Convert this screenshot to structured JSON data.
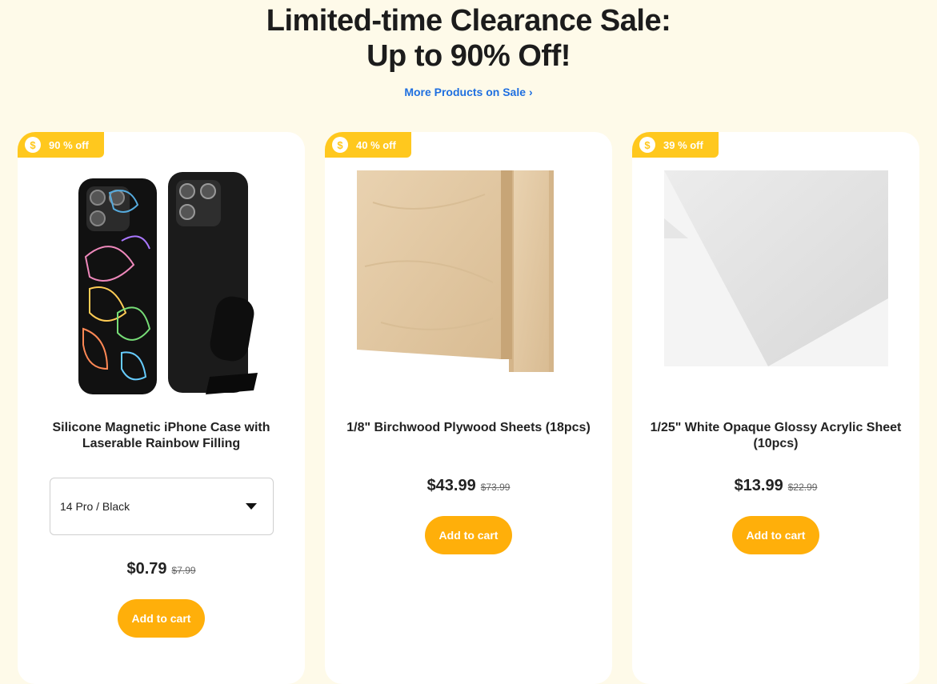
{
  "header": {
    "title_line1": "Limited-time Clearance Sale:",
    "title_line2": "Up to 90% Off!",
    "more_link": "More Products on Sale",
    "link_color": "#1f6fe0"
  },
  "colors": {
    "accent": "#ffc81e",
    "button": "#ffaf0a",
    "background": "#fefae9"
  },
  "products": [
    {
      "badge": "90 % off",
      "title": "Silicone Magnetic iPhone Case with Laserable Rainbow Filling",
      "variant": "14 Pro / Black",
      "price": "$0.79",
      "old_price": "$7.99",
      "cart_label": "Add to cart"
    },
    {
      "badge": "40 % off",
      "title": "1/8\" Birchwood Plywood Sheets (18pcs)",
      "price": "$43.99",
      "old_price": "$73.99",
      "cart_label": "Add to cart"
    },
    {
      "badge": "39 % off",
      "title": "1/25\" White Opaque Glossy Acrylic Sheet (10pcs)",
      "price": "$13.99",
      "old_price": "$22.99",
      "cart_label": "Add to cart"
    }
  ]
}
